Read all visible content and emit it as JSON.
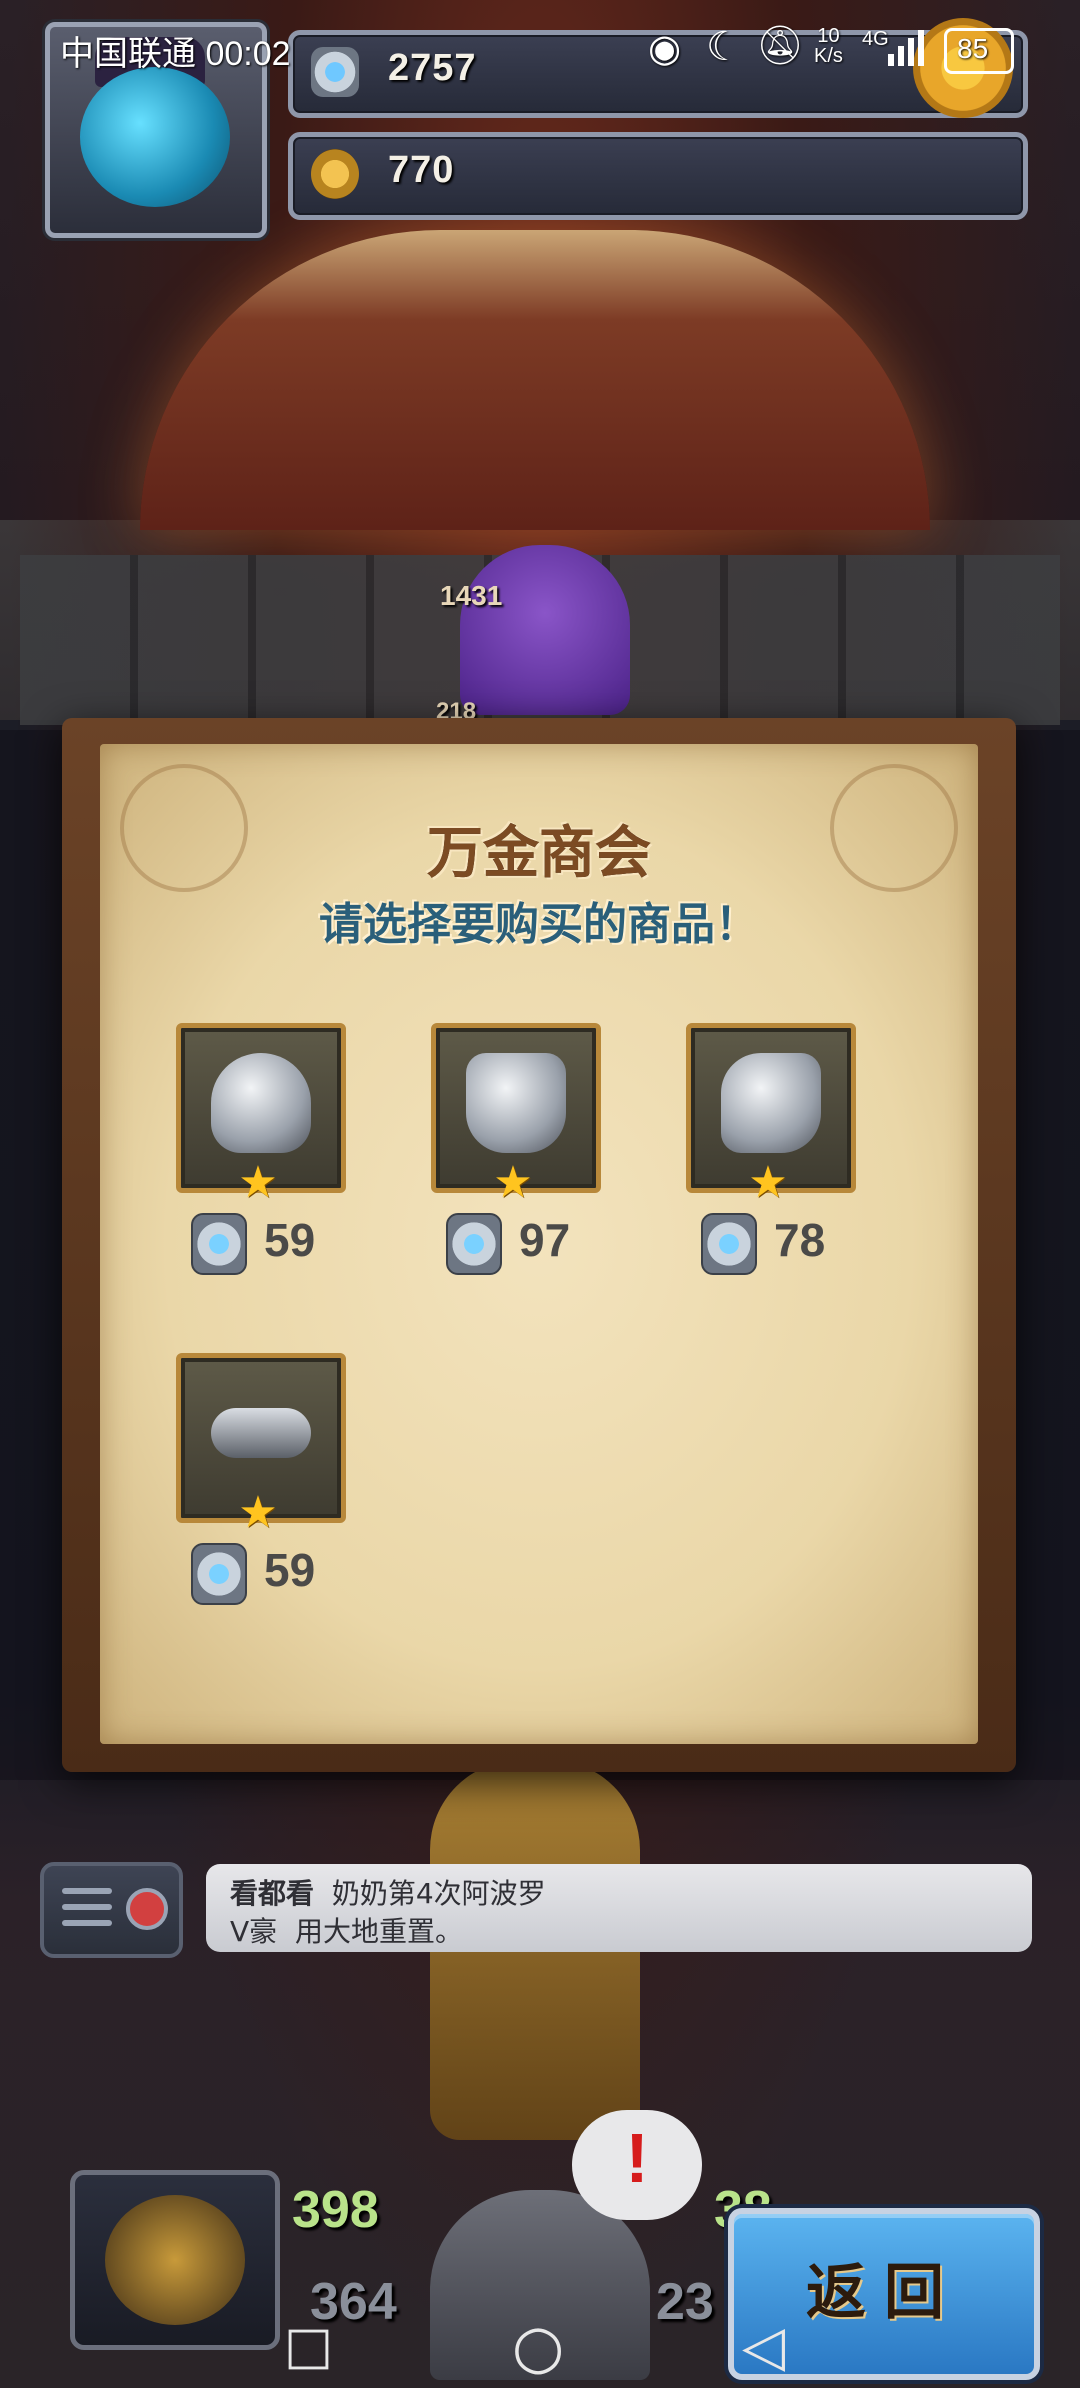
{
  "status_bar": {
    "carrier_time": "中国联通 00:02",
    "net_speed_top": "10",
    "net_speed_bottom": "K/s",
    "network": "4G",
    "battery": "85"
  },
  "hud": {
    "gems": "2757",
    "gold": "770"
  },
  "scene": {
    "enemy_hp_top": "1431",
    "enemy_hp_bottom": "218"
  },
  "shop": {
    "title": "万金商会",
    "subtitle": "请选择要购买的商品！",
    "items": [
      {
        "name": "winged-helmet",
        "price": "59",
        "stars": 1
      },
      {
        "name": "plate-armor",
        "price": "97",
        "stars": 1
      },
      {
        "name": "gauntlet",
        "price": "78",
        "stars": 1
      },
      {
        "name": "ring",
        "price": "59",
        "stars": 1
      }
    ]
  },
  "chat": {
    "line1_user": "看都看",
    "line1_text": "奶奶第4次阿波罗",
    "line2_user": "V豪",
    "line2_text": "用大地重置。"
  },
  "bottom": {
    "left_stat_top": "398",
    "left_stat_bottom": "364",
    "right_stat_top": "38",
    "right_stat_bottom": "23",
    "alert_symbol": "!",
    "back_label": "返回"
  },
  "nav": {
    "recent_icon": "□",
    "home_icon": "○",
    "back_icon": "◁"
  },
  "colors": {
    "accent_blue": "#3d95dd",
    "parchment": "#ead7a8",
    "title_brown": "#7c4b23",
    "subtitle_blue": "#2a5f7a",
    "star_gold": "#ffc41f"
  }
}
